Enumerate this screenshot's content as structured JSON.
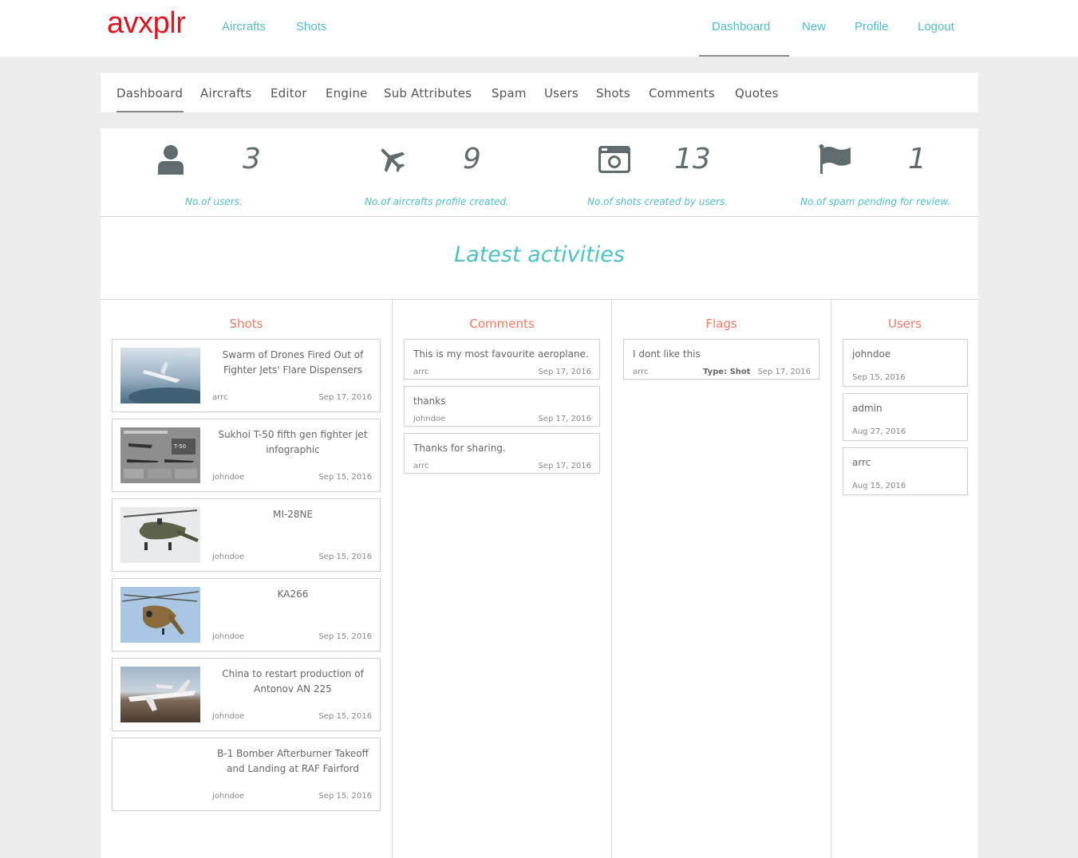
{
  "brand": "avxplr",
  "topnav": {
    "left": [
      "Aircrafts",
      "Shots"
    ],
    "right": [
      "Dashboard",
      "New",
      "Profile",
      "Logout"
    ]
  },
  "admin_tabs": [
    "Dashboard",
    "Aircrafts",
    "Editor",
    "Engine",
    "Sub Attributes",
    "Spam",
    "Users",
    "Shots",
    "Comments",
    "Quotes"
  ],
  "stats": [
    {
      "icon": "user-icon",
      "value": "3",
      "label": "No.of users."
    },
    {
      "icon": "airplane-icon",
      "value": "9",
      "label": "No.of aircrafts profile created."
    },
    {
      "icon": "camera-icon",
      "value": "13",
      "label": "No.of shots created by users."
    },
    {
      "icon": "flag-icon",
      "value": "1",
      "label": "No.of spam pending for review."
    }
  ],
  "latest_title": "Latest activities",
  "columns": {
    "shots": "Shots",
    "comments": "Comments",
    "flags": "Flags",
    "users": "Users"
  },
  "shots": [
    {
      "title": "Swarm of Drones Fired Out of Fighter Jets' Flare Dispensers",
      "user": "arrc",
      "date": "Sep 17, 2016",
      "thumb": "drones"
    },
    {
      "title": "Sukhoi T-50 fifth gen fighter jet infographic",
      "user": "johndoe",
      "date": "Sep 15, 2016",
      "thumb": "infographic"
    },
    {
      "title": "MI-28NE",
      "user": "johndoe",
      "date": "Sep 15, 2016",
      "thumb": "helicopter"
    },
    {
      "title": "KA266",
      "user": "johndoe",
      "date": "Sep 15, 2016",
      "thumb": "ka266"
    },
    {
      "title": "China to restart production of Antonov AN 225",
      "user": "johndoe",
      "date": "Sep 15, 2016",
      "thumb": "antonov"
    },
    {
      "title": "B-1 Bomber Afterburner Takeoff and Landing at RAF Fairford",
      "user": "johndoe",
      "date": "Sep 15, 2016",
      "thumb": ""
    }
  ],
  "comments": [
    {
      "text": "This is my most favourite aeroplane.",
      "user": "arrc",
      "date": "Sep 17, 2016"
    },
    {
      "text": "thanks",
      "user": "johndoe",
      "date": "Sep 17, 2016"
    },
    {
      "text": "Thanks for sharing.",
      "user": "arrc",
      "date": "Sep 17, 2016"
    }
  ],
  "flags": [
    {
      "text": "I dont like this",
      "user": "arrc",
      "type": "Type: Shot",
      "date": "Sep 17, 2016"
    }
  ],
  "users": [
    {
      "name": "johndoe",
      "date": "Sep 15, 2016"
    },
    {
      "name": "admin",
      "date": "Aug 27, 2016"
    },
    {
      "name": "arrc",
      "date": "Aug 15, 2016"
    }
  ],
  "colors": {
    "brand": "#e0141e",
    "accent": "#4fc1c3",
    "column_heading": "#ef7a62",
    "icon": "#5f6b6d"
  }
}
